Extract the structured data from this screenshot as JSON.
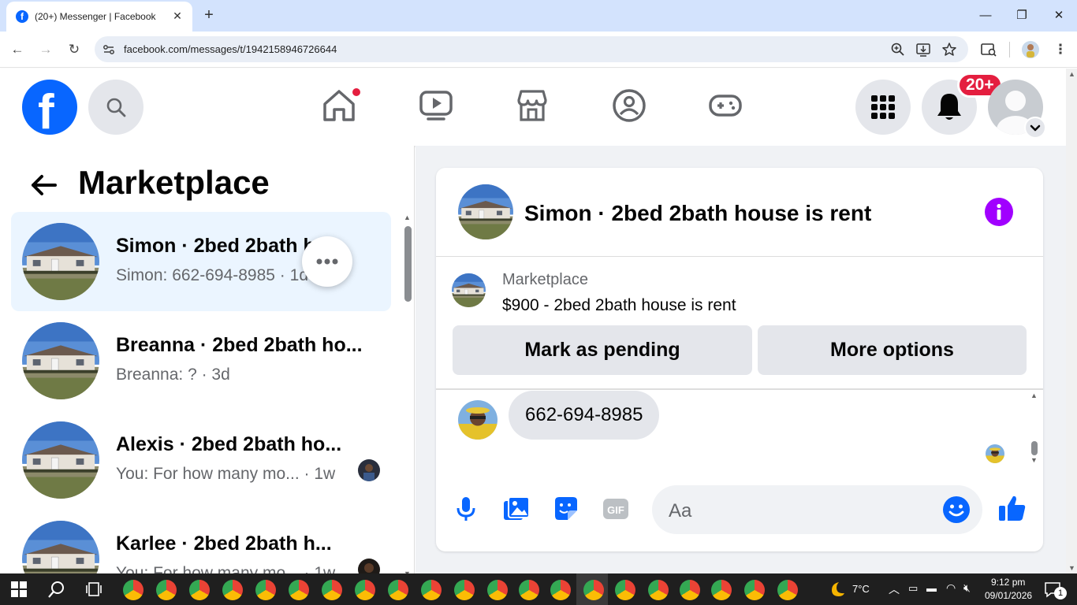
{
  "browser": {
    "tab_title": "(20+) Messenger | Facebook",
    "url": "facebook.com/messages/t/1942158946726644"
  },
  "header": {
    "notification_badge": "20+"
  },
  "left_panel": {
    "title": "Marketplace",
    "conversations": [
      {
        "name": "Simon · 2bed 2bath h...",
        "snippet": "Simon: 662-694-8985 · 1d",
        "active": true
      },
      {
        "name": "Breanna · 2bed 2bath ho...",
        "snippet": "Breanna: ? · 3d",
        "active": false
      },
      {
        "name": "Alexis · 2bed 2bath ho...",
        "snippet": "You: For how many mo... · 1w",
        "active": false
      },
      {
        "name": "Karlee · 2bed 2bath h...",
        "snippet": "You: For how many mo... · 1w",
        "active": false
      }
    ]
  },
  "chat": {
    "title": "Simon · 2bed 2bath house is rent",
    "marketplace_label": "Marketplace",
    "listing": "$900 - 2bed 2bath house is rent",
    "mark_pending_label": "Mark as pending",
    "more_options_label": "More options",
    "message": "662-694-8985",
    "composer_placeholder": "Aa"
  },
  "taskbar": {
    "weather": "7°C",
    "time": "9:12 pm",
    "date": "09/01/2026",
    "notification_count": "1"
  },
  "colors": {
    "facebook_blue": "#0866ff",
    "badge_red": "#e41e3f",
    "info_purple": "#a100ff",
    "active_row": "#ebf5ff"
  }
}
